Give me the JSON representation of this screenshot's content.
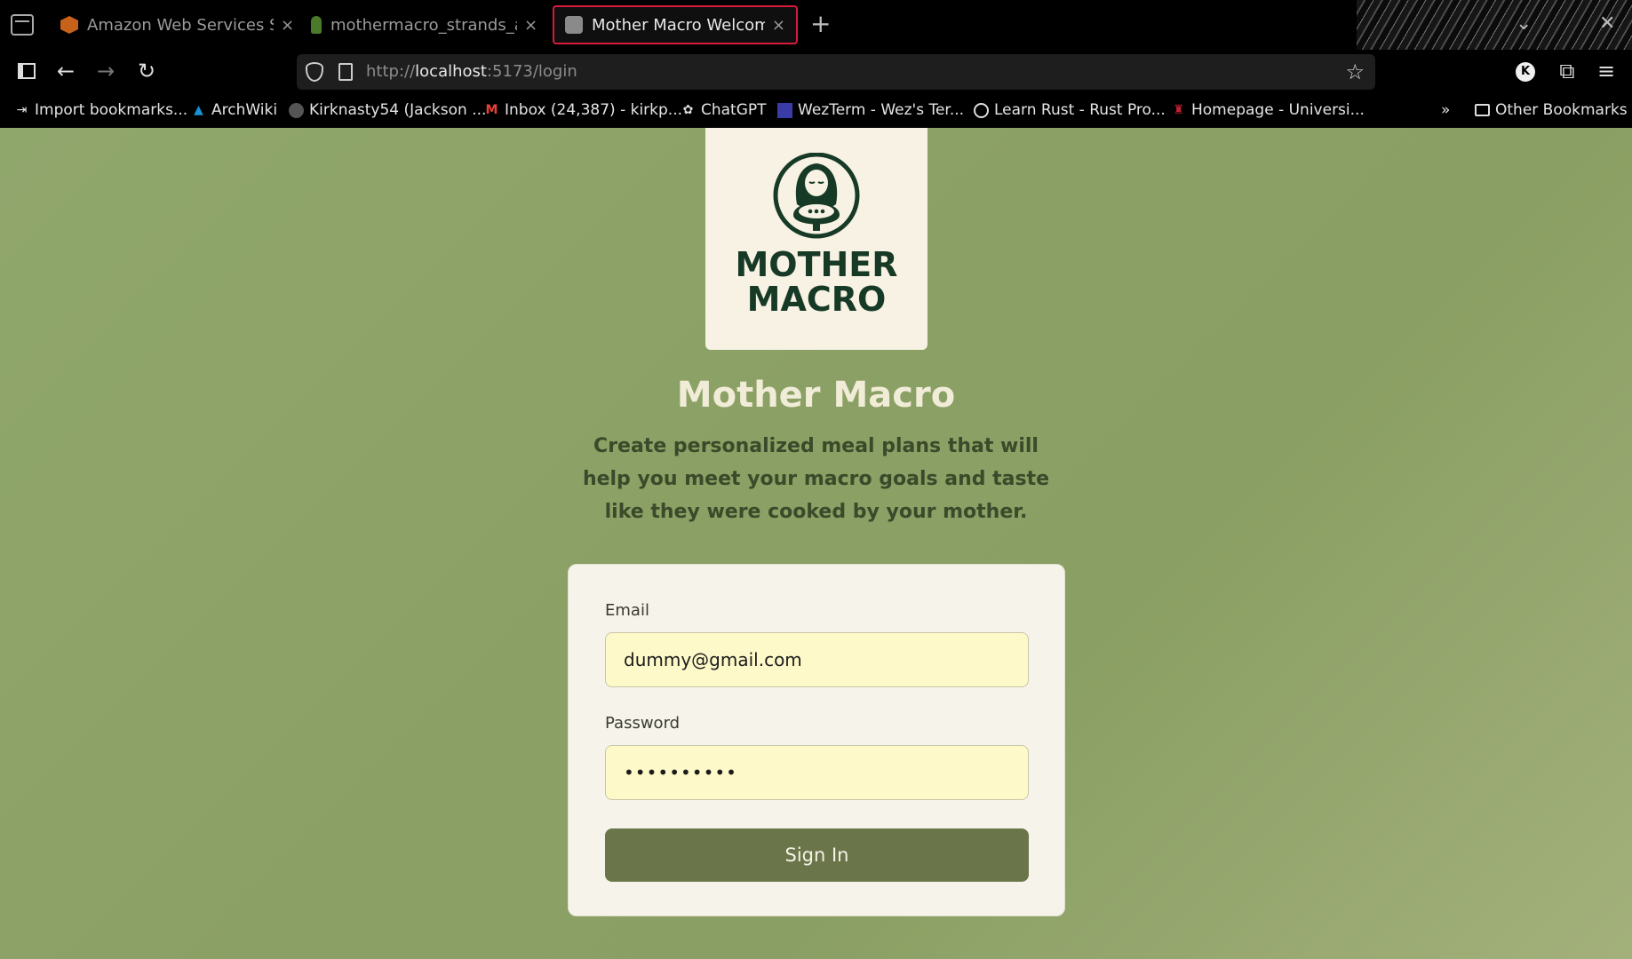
{
  "browser": {
    "tabs": [
      {
        "title": "Amazon Web Services Sign",
        "favicon_color": "#c8611a"
      },
      {
        "title": "mothermacro_strands_age",
        "favicon_color": "#4a7a2a"
      },
      {
        "title": "Mother Macro Welcome",
        "favicon_color": "#8a8a8a"
      }
    ],
    "close_glyph": "×",
    "new_tab_glyph": "+",
    "url_prefix": "http://",
    "url_host": "localhost",
    "url_rest": ":5173/login",
    "account_initial": "K",
    "bookmarks": [
      {
        "label": "Import bookmarks...",
        "icon": "import-icon"
      },
      {
        "label": "ArchWiki",
        "icon": "arch-icon"
      },
      {
        "label": "Kirknasty54 (Jackson ...",
        "icon": "github-icon"
      },
      {
        "label": "Inbox (24,387) - kirkp...",
        "icon": "gmail-icon"
      },
      {
        "label": "ChatGPT",
        "icon": "chatgpt-icon"
      },
      {
        "label": "WezTerm - Wez's Ter...",
        "icon": "wezterm-icon"
      },
      {
        "label": "Learn Rust - Rust Pro...",
        "icon": "rust-icon"
      },
      {
        "label": "Homepage - Universi...",
        "icon": "university-icon"
      }
    ],
    "other_bookmarks": "Other Bookmarks"
  },
  "logo": {
    "line1": "MOTHER",
    "line2": "MACRO",
    "color": "#173a27"
  },
  "hero": {
    "title": "Mother Macro",
    "tagline": "Create personalized meal plans that will help you meet your macro goals and taste like they were cooked by your mother."
  },
  "login": {
    "email_label": "Email",
    "email_value": "dummy@gmail.com",
    "password_label": "Password",
    "password_value": "••••••••••",
    "submit_label": "Sign In",
    "button_color": "#6a764a",
    "input_bg": "#fef9c8"
  }
}
